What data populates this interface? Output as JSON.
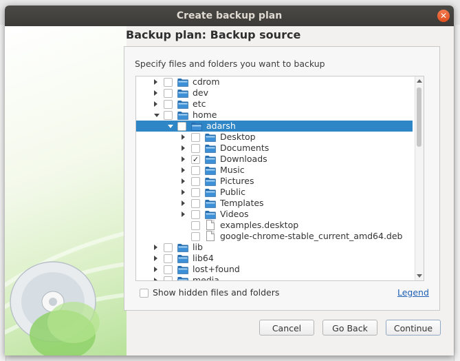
{
  "dialog": {
    "title": "Create backup plan",
    "heading": "Backup plan: Backup source",
    "instruction": "Specify files and folders you want to backup"
  },
  "tree": {
    "rows": [
      {
        "label": "cdrom",
        "type": "folder",
        "depth": 0,
        "expander": "collapsed",
        "checked": false,
        "selected": false
      },
      {
        "label": "dev",
        "type": "folder",
        "depth": 0,
        "expander": "collapsed",
        "checked": false,
        "selected": false
      },
      {
        "label": "etc",
        "type": "folder",
        "depth": 0,
        "expander": "collapsed",
        "checked": false,
        "selected": false
      },
      {
        "label": "home",
        "type": "folder",
        "depth": 0,
        "expander": "expanded",
        "checked": false,
        "selected": false
      },
      {
        "label": "adarsh",
        "type": "folder",
        "depth": 1,
        "expander": "expanded",
        "checked": false,
        "selected": true
      },
      {
        "label": "Desktop",
        "type": "folder",
        "depth": 2,
        "expander": "collapsed",
        "checked": false,
        "selected": false
      },
      {
        "label": "Documents",
        "type": "folder",
        "depth": 2,
        "expander": "collapsed",
        "checked": false,
        "selected": false
      },
      {
        "label": "Downloads",
        "type": "folder",
        "depth": 2,
        "expander": "collapsed",
        "checked": true,
        "selected": false
      },
      {
        "label": "Music",
        "type": "folder",
        "depth": 2,
        "expander": "collapsed",
        "checked": false,
        "selected": false
      },
      {
        "label": "Pictures",
        "type": "folder",
        "depth": 2,
        "expander": "collapsed",
        "checked": false,
        "selected": false
      },
      {
        "label": "Public",
        "type": "folder",
        "depth": 2,
        "expander": "collapsed",
        "checked": false,
        "selected": false
      },
      {
        "label": "Templates",
        "type": "folder",
        "depth": 2,
        "expander": "collapsed",
        "checked": false,
        "selected": false
      },
      {
        "label": "Videos",
        "type": "folder",
        "depth": 2,
        "expander": "collapsed",
        "checked": false,
        "selected": false
      },
      {
        "label": "examples.desktop",
        "type": "file",
        "depth": 2,
        "expander": "none",
        "checked": false,
        "selected": false
      },
      {
        "label": "google-chrome-stable_current_amd64.deb",
        "type": "file",
        "depth": 2,
        "expander": "none",
        "checked": false,
        "selected": false
      },
      {
        "label": "lib",
        "type": "folder",
        "depth": 0,
        "expander": "collapsed",
        "checked": false,
        "selected": false
      },
      {
        "label": "lib64",
        "type": "folder",
        "depth": 0,
        "expander": "collapsed",
        "checked": false,
        "selected": false
      },
      {
        "label": "lost+found",
        "type": "folder",
        "depth": 0,
        "expander": "collapsed",
        "checked": false,
        "selected": false
      },
      {
        "label": "media",
        "type": "folder",
        "depth": 0,
        "expander": "collapsed",
        "checked": false,
        "selected": false
      }
    ]
  },
  "options": {
    "show_hidden_label": "Show hidden files and folders",
    "show_hidden_checked": false,
    "legend_label": "Legend"
  },
  "buttons": {
    "cancel": "Cancel",
    "go_back": "Go Back",
    "continue": "Continue"
  },
  "colors": {
    "selection": "#2f86c7",
    "folder": "#3d8fd6",
    "titlebar": "#3c3b37",
    "close": "#e0501f"
  }
}
